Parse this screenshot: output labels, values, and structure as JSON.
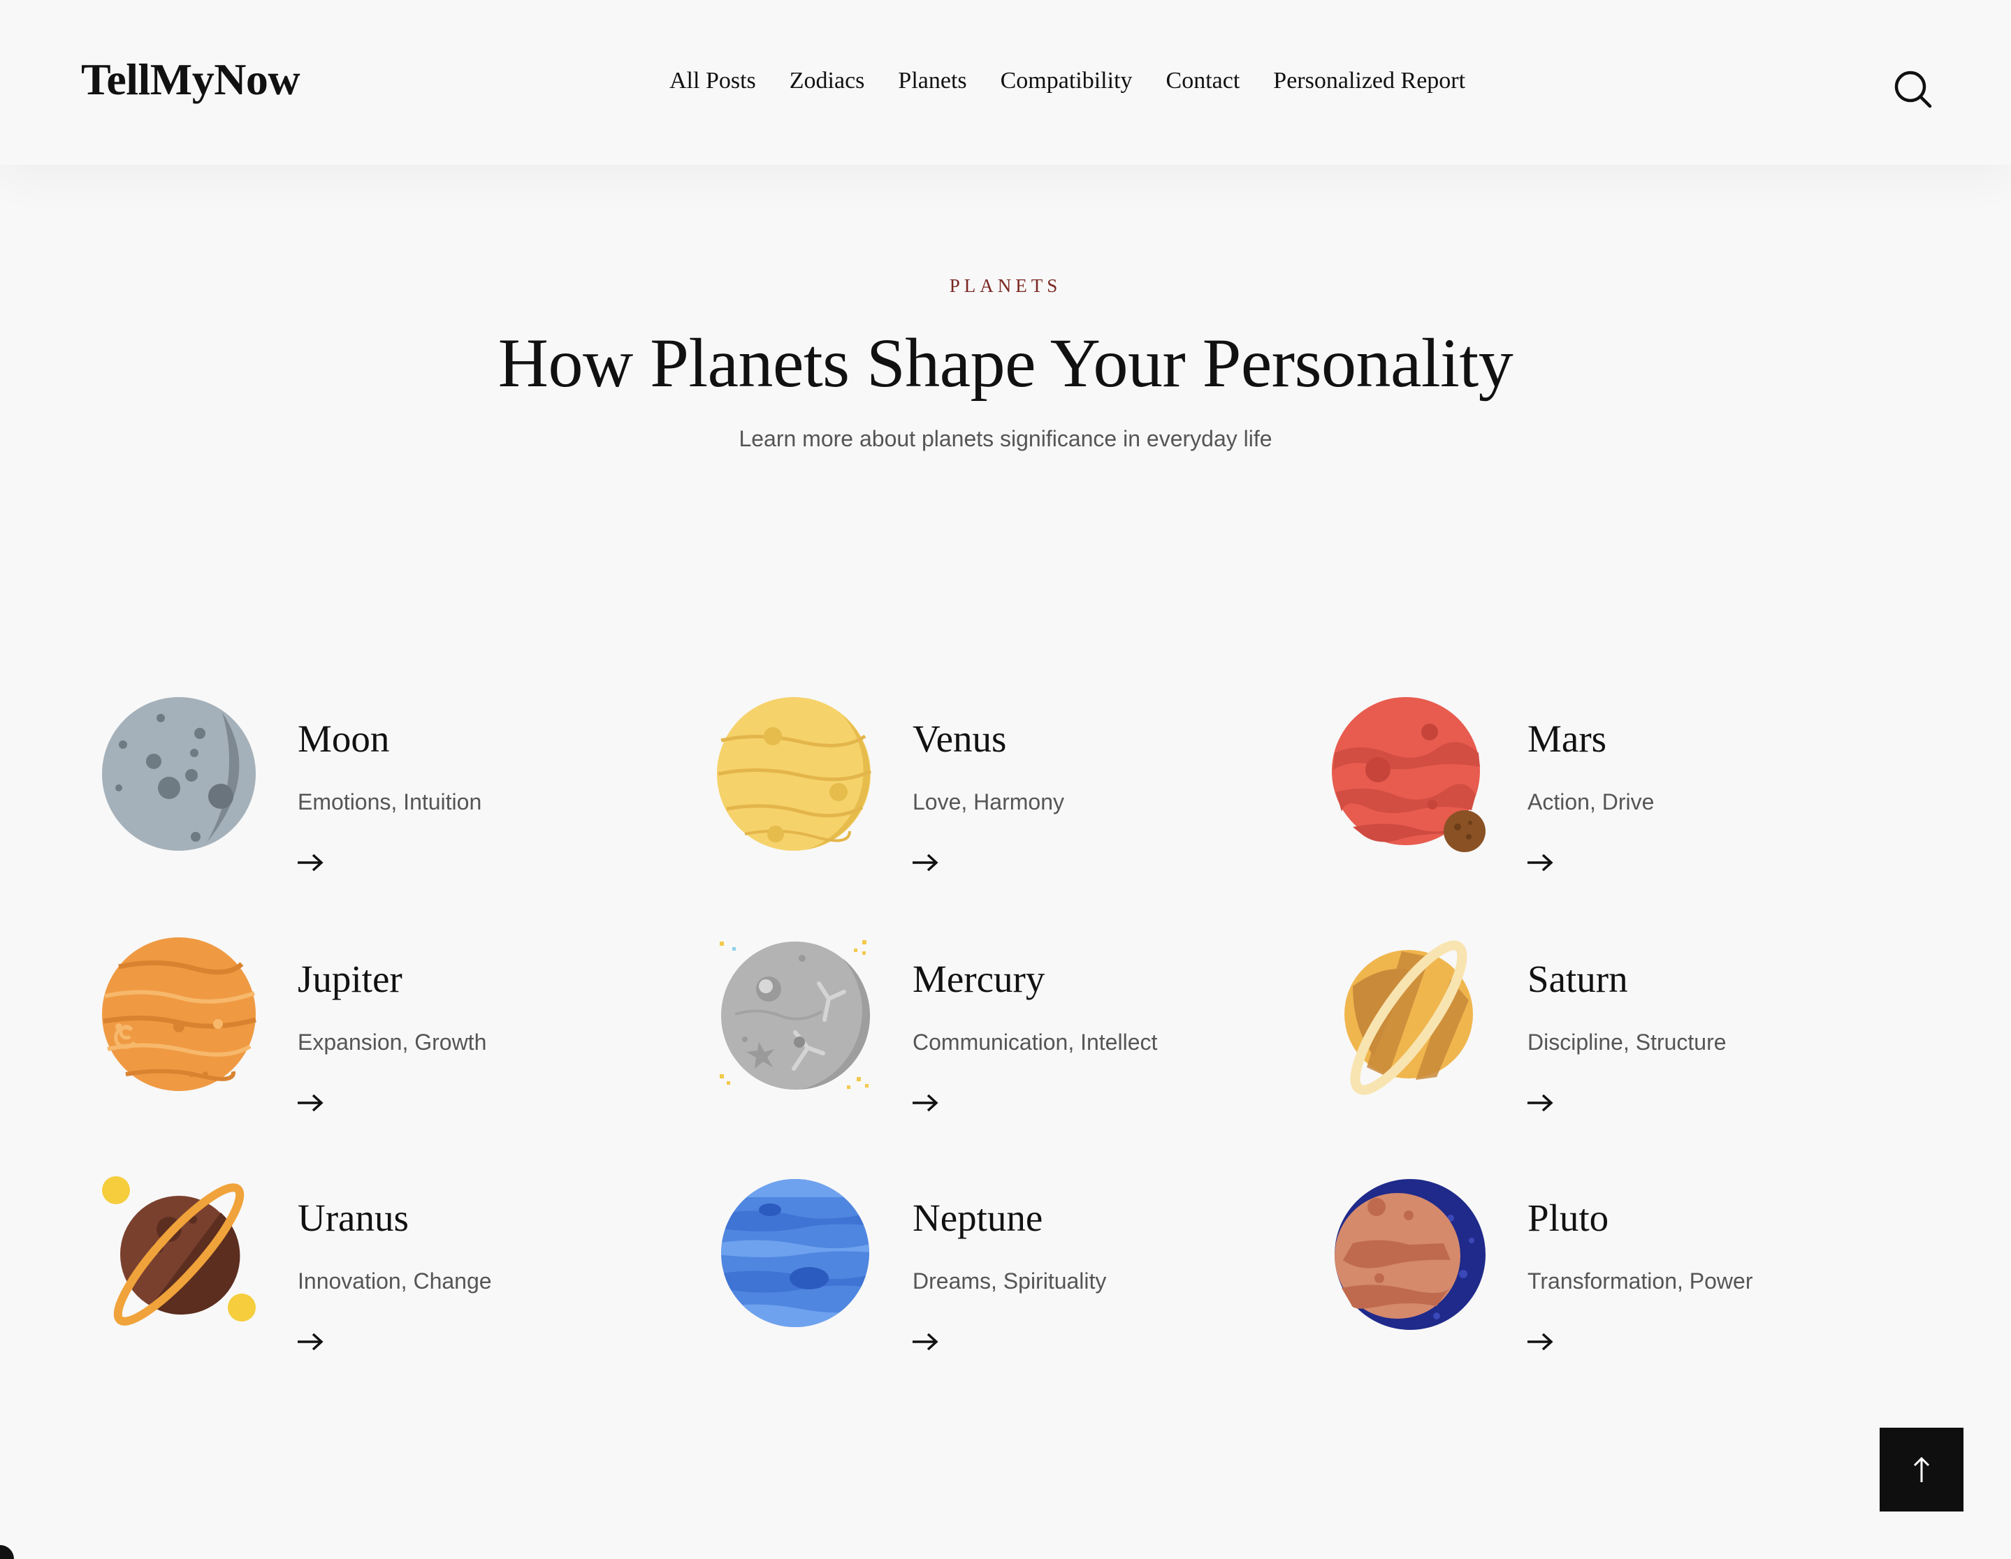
{
  "header": {
    "logo": "TellMyNow",
    "nav": [
      "All Posts",
      "Zodiacs",
      "Planets",
      "Compatibility",
      "Contact",
      "Personalized Report"
    ],
    "search_icon": "search-icon"
  },
  "hero": {
    "eyebrow": "PLANETS",
    "title": "How Planets Shape Your Personality",
    "subtitle": "Learn more about planets significance in everyday life"
  },
  "planets": [
    {
      "name": "Moon",
      "traits": "Emotions, Intuition"
    },
    {
      "name": "Venus",
      "traits": "Love, Harmony"
    },
    {
      "name": "Mars",
      "traits": "Action, Drive"
    },
    {
      "name": "Jupiter",
      "traits": "Expansion, Growth"
    },
    {
      "name": "Mercury",
      "traits": "Communication, Intellect"
    },
    {
      "name": "Saturn",
      "traits": "Discipline, Structure"
    },
    {
      "name": "Uranus",
      "traits": "Innovation, Change"
    },
    {
      "name": "Neptune",
      "traits": "Dreams, Spirituality"
    },
    {
      "name": "Pluto",
      "traits": "Transformation, Power"
    }
  ],
  "colors": {
    "background": "#f8f8f8",
    "eyebrow": "#7a2722",
    "text": "#111111",
    "muted": "#555555",
    "back_to_top": "#0f0f0f"
  }
}
